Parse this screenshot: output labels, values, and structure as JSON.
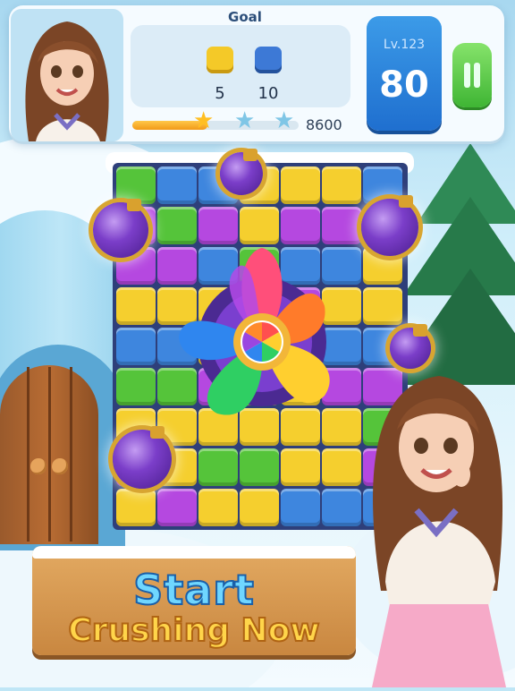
{
  "hud": {
    "goal_title": "Goal",
    "goals": [
      {
        "icon": "yellow-cube-icon",
        "color": "#f4c928",
        "count": "5"
      },
      {
        "icon": "blue-cube-icon",
        "color": "#3d79d6",
        "count": "10"
      }
    ],
    "progress_fraction": 0.45,
    "score": "8600",
    "level_label": "Lv.123",
    "moves": "80"
  },
  "promo": {
    "line1": "Start",
    "line2": "Crushing Now"
  },
  "colors": {
    "yellow": "#f5cf2e",
    "green": "#55c43a",
    "blue": "#3e86de",
    "purple": "#b548e0",
    "pink": "#ee4fa6"
  }
}
